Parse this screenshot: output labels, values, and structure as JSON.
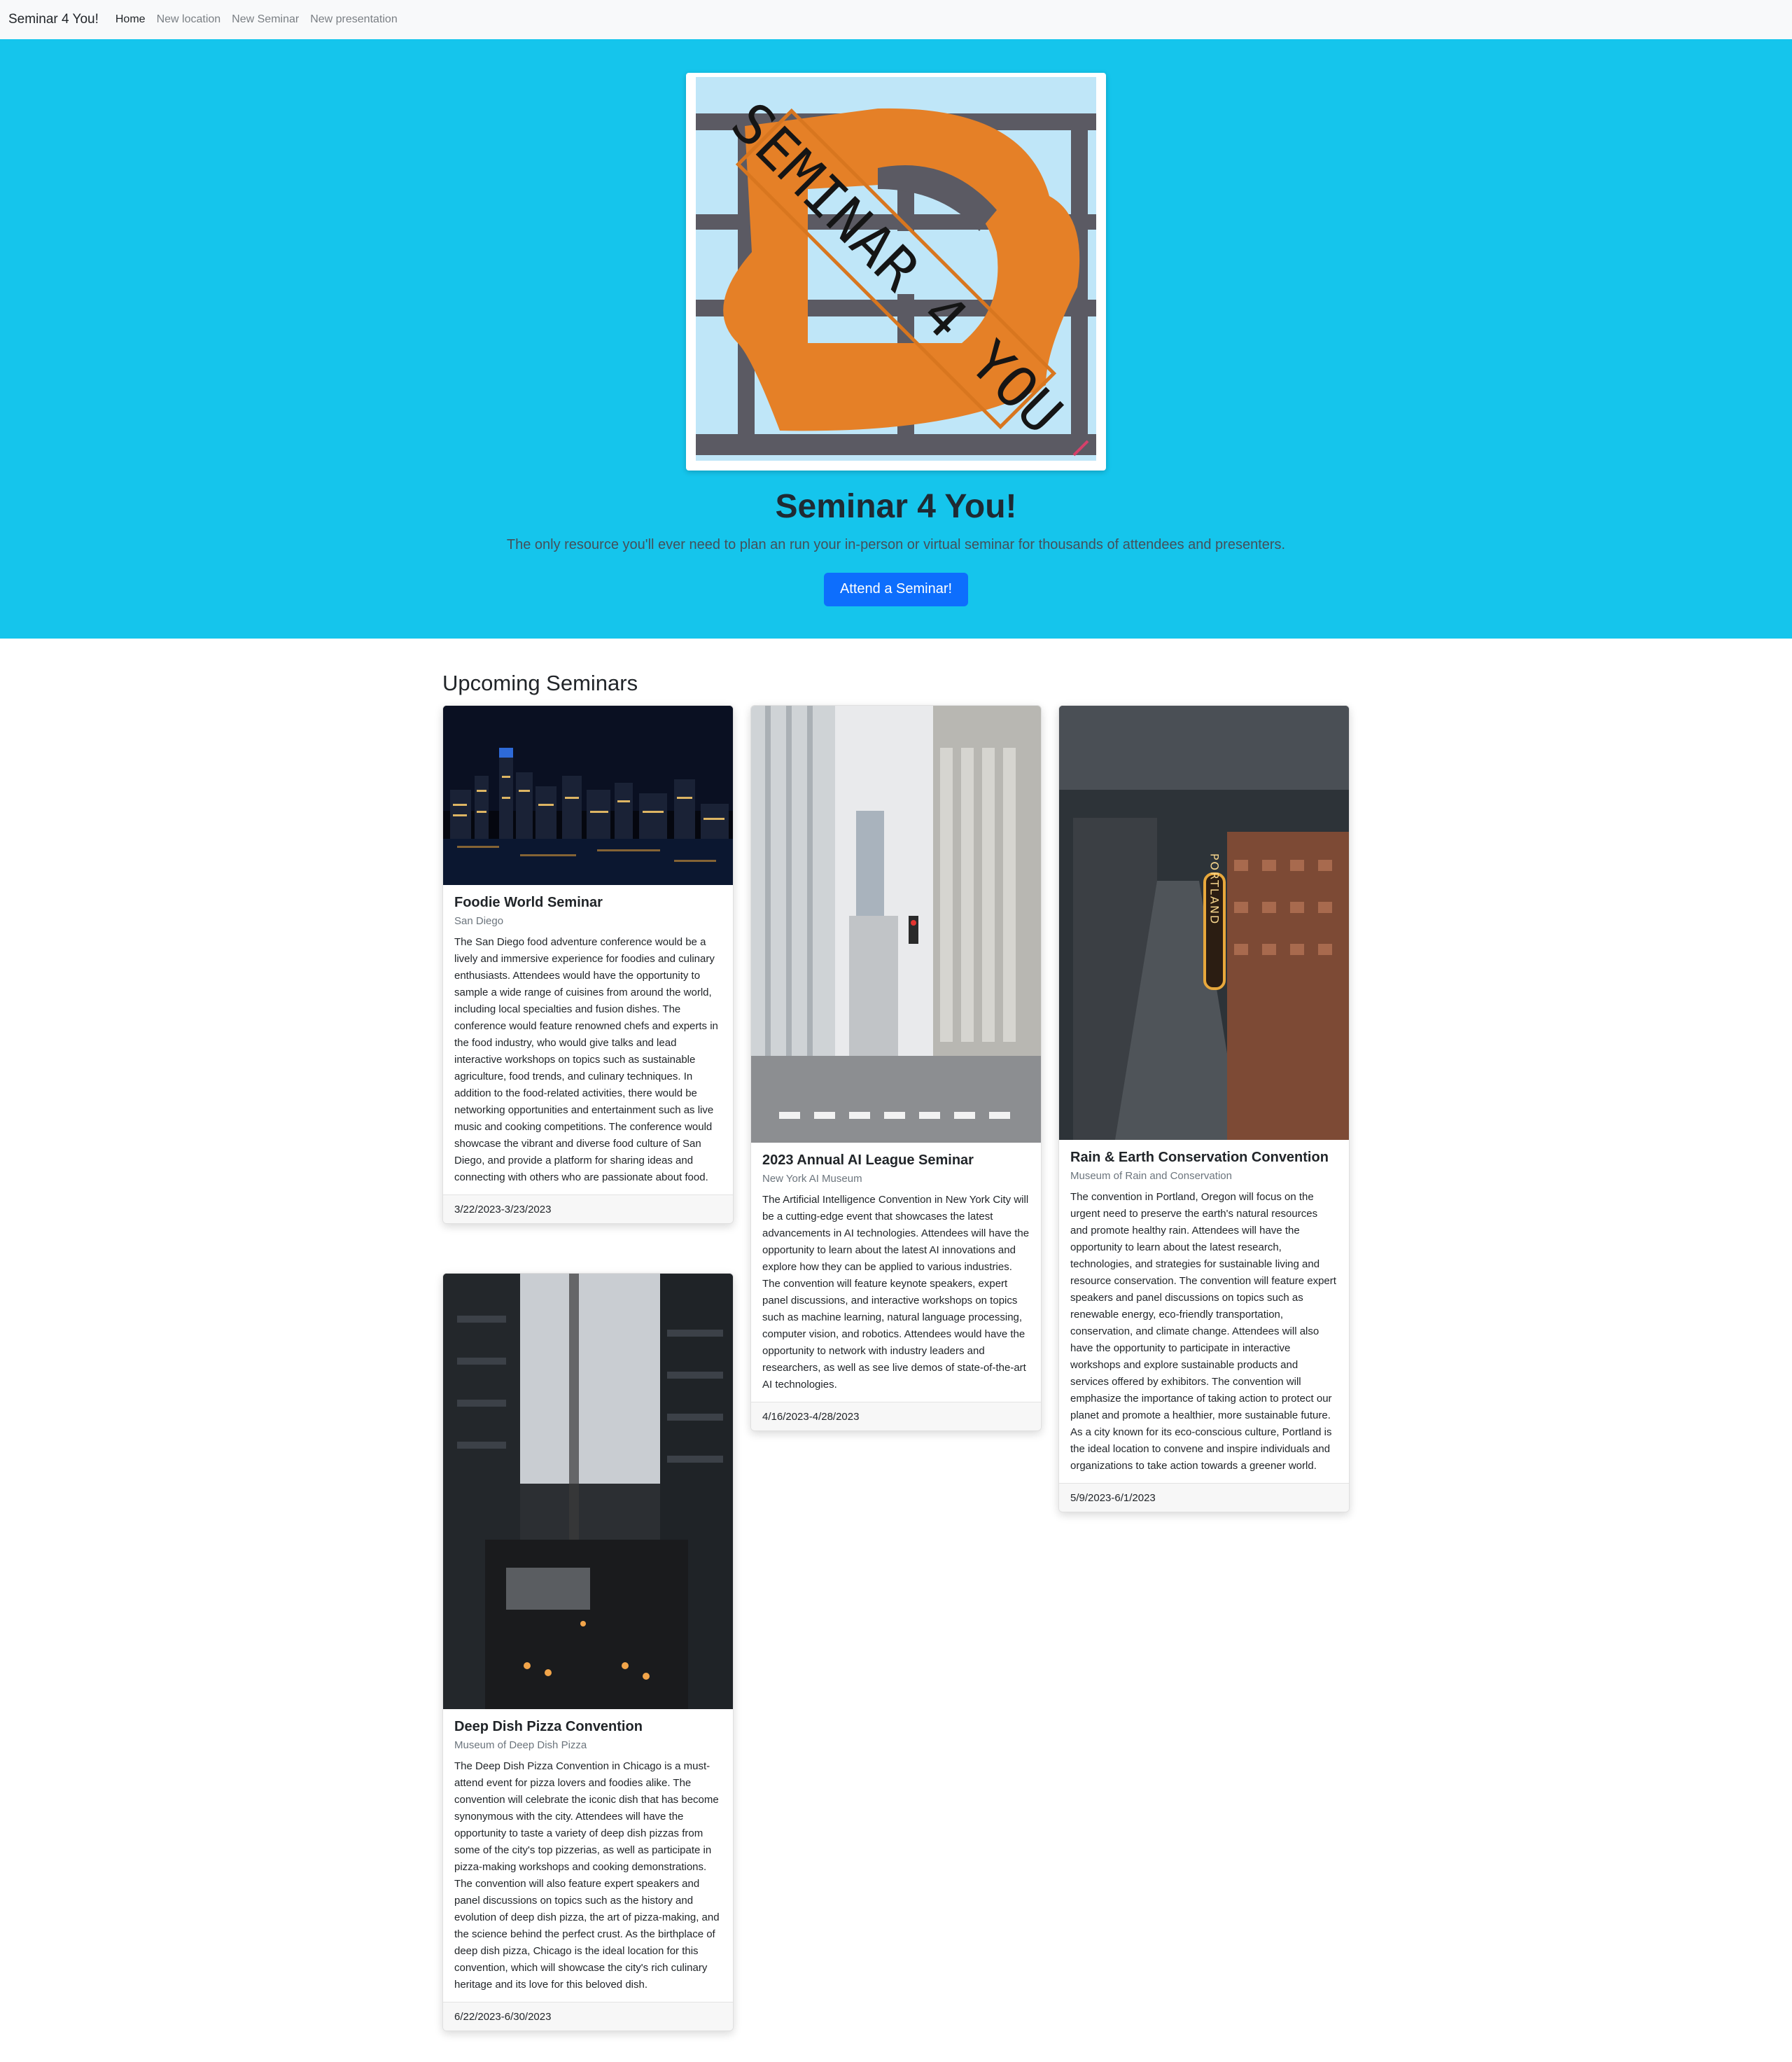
{
  "nav": {
    "brand": "Seminar 4 You!",
    "links": [
      "Home",
      "New location",
      "New Seminar",
      "New presentation"
    ]
  },
  "hero": {
    "logo_text": "SEMINAR 4 YOU",
    "title": "Seminar 4 You!",
    "subtitle": "The only resource you'll ever need to plan an run your in-person or virtual seminar for thousands of attendees and presenters.",
    "button": "Attend a Seminar!"
  },
  "upcoming": {
    "title": "Upcoming Seminars",
    "cards": [
      {
        "title": "Foodie World Seminar",
        "location": "San Diego",
        "text": "The San Diego food adventure conference would be a lively and immersive experience for foodies and culinary enthusiasts. Attendees would have the opportunity to sample a wide range of cuisines from around the world, including local specialties and fusion dishes. The conference would feature renowned chefs and experts in the food industry, who would give talks and lead interactive workshops on topics such as sustainable agriculture, food trends, and culinary techniques. In addition to the food-related activities, there would be networking opportunities and entertainment such as live music and cooking competitions. The conference would showcase the vibrant and diverse food culture of San Diego, and provide a platform for sharing ideas and connecting with others who are passionate about food.",
        "dates": "3/22/2023-3/23/2023"
      },
      {
        "title": "2023 Annual AI League Seminar",
        "location": "New York AI Museum",
        "text": "The Artificial Intelligence Convention in New York City will be a cutting-edge event that showcases the latest advancements in AI technologies. Attendees will have the opportunity to learn about the latest AI innovations and explore how they can be applied to various industries. The convention will feature keynote speakers, expert panel discussions, and interactive workshops on topics such as machine learning, natural language processing, computer vision, and robotics. Attendees would have the opportunity to network with industry leaders and researchers, as well as see live demos of state-of-the-art AI technologies.",
        "dates": "4/16/2023-4/28/2023"
      },
      {
        "title": "Rain & Earth Conservation Convention",
        "location": "Museum of Rain and Conservation",
        "text": "The convention in Portland, Oregon will focus on the urgent need to preserve the earth's natural resources and promote healthy rain. Attendees will have the opportunity to learn about the latest research, technologies, and strategies for sustainable living and resource conservation. The convention will feature expert speakers and panel discussions on topics such as renewable energy, eco-friendly transportation, conservation, and climate change. Attendees will also have the opportunity to participate in interactive workshops and explore sustainable products and services offered by exhibitors. The convention will emphasize the importance of taking action to protect our planet and promote a healthier, more sustainable future. As a city known for its eco-conscious culture, Portland is the ideal location to convene and inspire individuals and organizations to take action towards a greener world.",
        "dates": "5/9/2023-6/1/2023",
        "sign_text": "PORTLAND"
      },
      {
        "title": "Deep Dish Pizza Convention",
        "location": "Museum of Deep Dish Pizza",
        "text": "The Deep Dish Pizza Convention in Chicago is a must-attend event for pizza lovers and foodies alike. The convention will celebrate the iconic dish that has become synonymous with the city. Attendees will have the opportunity to taste a variety of deep dish pizzas from some of the city's top pizzerias, as well as participate in pizza-making workshops and cooking demonstrations. The convention will also feature expert speakers and panel discussions on topics such as the history and evolution of deep dish pizza, the art of pizza-making, and the science behind the perfect crust. As the birthplace of deep dish pizza, Chicago is the ideal location for this convention, which will showcase the city's rich culinary heritage and its love for this beloved dish.",
        "dates": "6/22/2023-6/30/2023"
      }
    ]
  }
}
